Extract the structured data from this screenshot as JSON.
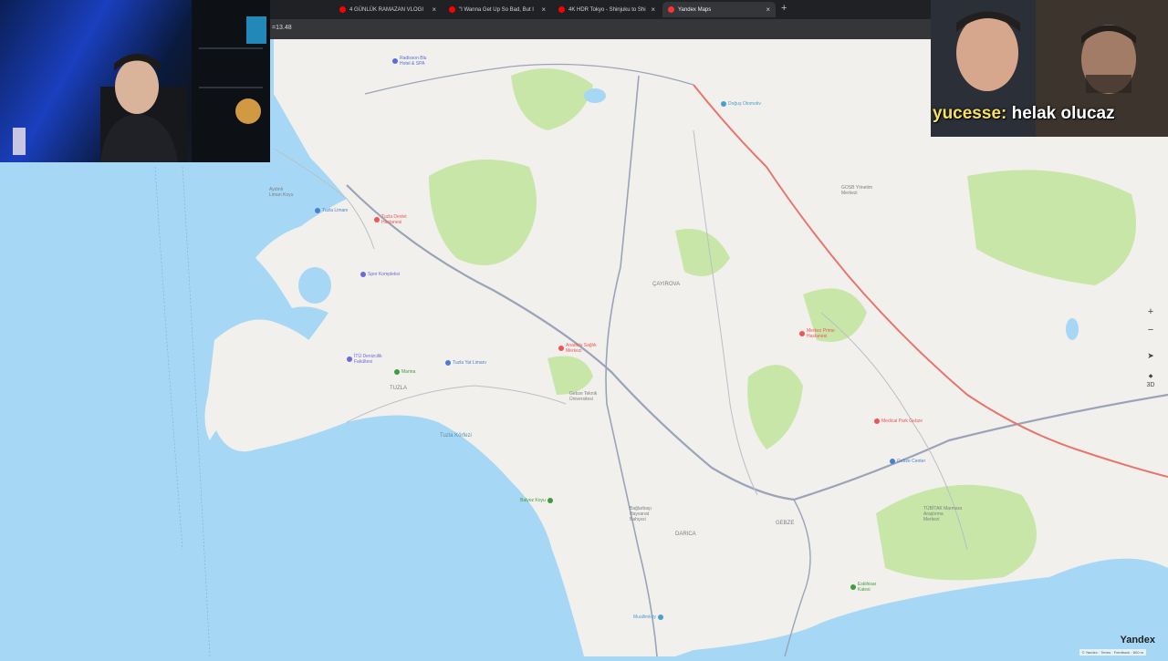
{
  "browser": {
    "tabs": [
      {
        "label": "4 GÜNLÜK RAMAZAN VLOGI",
        "favicon_color": "#ff0000",
        "active": false
      },
      {
        "label": "\"I Wanna Get Up So Bad, But I",
        "favicon_color": "#ff0000",
        "active": false
      },
      {
        "label": "4K HDR Tokyo - Shinjuku to Shi",
        "favicon_color": "#ff0000",
        "active": false
      },
      {
        "label": "Yandex Maps",
        "favicon_color": "#ff3333",
        "active": true
      }
    ],
    "close_glyph": "×",
    "new_tab_glyph": "+",
    "address_text": "=13.48"
  },
  "map": {
    "water_color": "#a6d8f5",
    "land_color": "#f2f0ec",
    "park_color": "#c8e6a8",
    "labels": [
      {
        "text": "Aydınlı\nLiman Koyu"
      },
      {
        "text": "Tuzla Körfezi"
      },
      {
        "text": "ÇAYIROVA"
      },
      {
        "text": "TUZLA"
      },
      {
        "text": "DARICA"
      },
      {
        "text": "GEBZE"
      },
      {
        "text": "TÜBİTAK Marmara\nAraştırma\nMerkezi"
      },
      {
        "text": "GOSB Yönetim\nMerkezi"
      },
      {
        "text": "Gebze Teknik\nÜniversitesi"
      },
      {
        "text": "Bağlarbaşı\nHayvanat\nBahçesi"
      }
    ],
    "pois": [
      {
        "text": "Radisson Blu\nHotel & SPA",
        "color": "#5a6cd8"
      },
      {
        "text": "Tuzla Limanı",
        "color": "#4a7fd0"
      },
      {
        "text": "Tuzla Devlet\nHastanesi",
        "color": "#e55"
      },
      {
        "text": "Spor Kompleksi",
        "color": "#6a6ad8"
      },
      {
        "text": "İTÜ Denizcilik\nFakültesi",
        "color": "#6a6ad8"
      },
      {
        "text": "Marina",
        "color": "#3f9b3f"
      },
      {
        "text": "Tuzla Yat Limanı",
        "color": "#4a7fd0"
      },
      {
        "text": "Anadolu Sağlık\nMerkezi",
        "color": "#e55"
      },
      {
        "text": "Doğuş Otomotiv",
        "color": "#4a9fd0"
      },
      {
        "text": "Medical Park Gebze",
        "color": "#e55"
      },
      {
        "text": "Gebze Center",
        "color": "#4a7fd0"
      },
      {
        "text": "Eskihisar\nKalesi",
        "color": "#3f9b3f"
      },
      {
        "text": "Muallimköy",
        "color": "#4a9fd0"
      },
      {
        "text": "Balyoz Koyu",
        "color": "#3f9b3f"
      },
      {
        "text": "Merkez Prime\nHastanesi",
        "color": "#e55"
      }
    ],
    "controls": {
      "zoom_in": "+",
      "zoom_out": "−",
      "locate": "➤",
      "3d": "3D",
      "compass": "◆"
    },
    "brand": "Yandex",
    "attribution": "© Yandex · Terms · Feedback · 800 m"
  },
  "overlay": {
    "chat_username": "yucesse:",
    "chat_message": " helak olucaz"
  }
}
